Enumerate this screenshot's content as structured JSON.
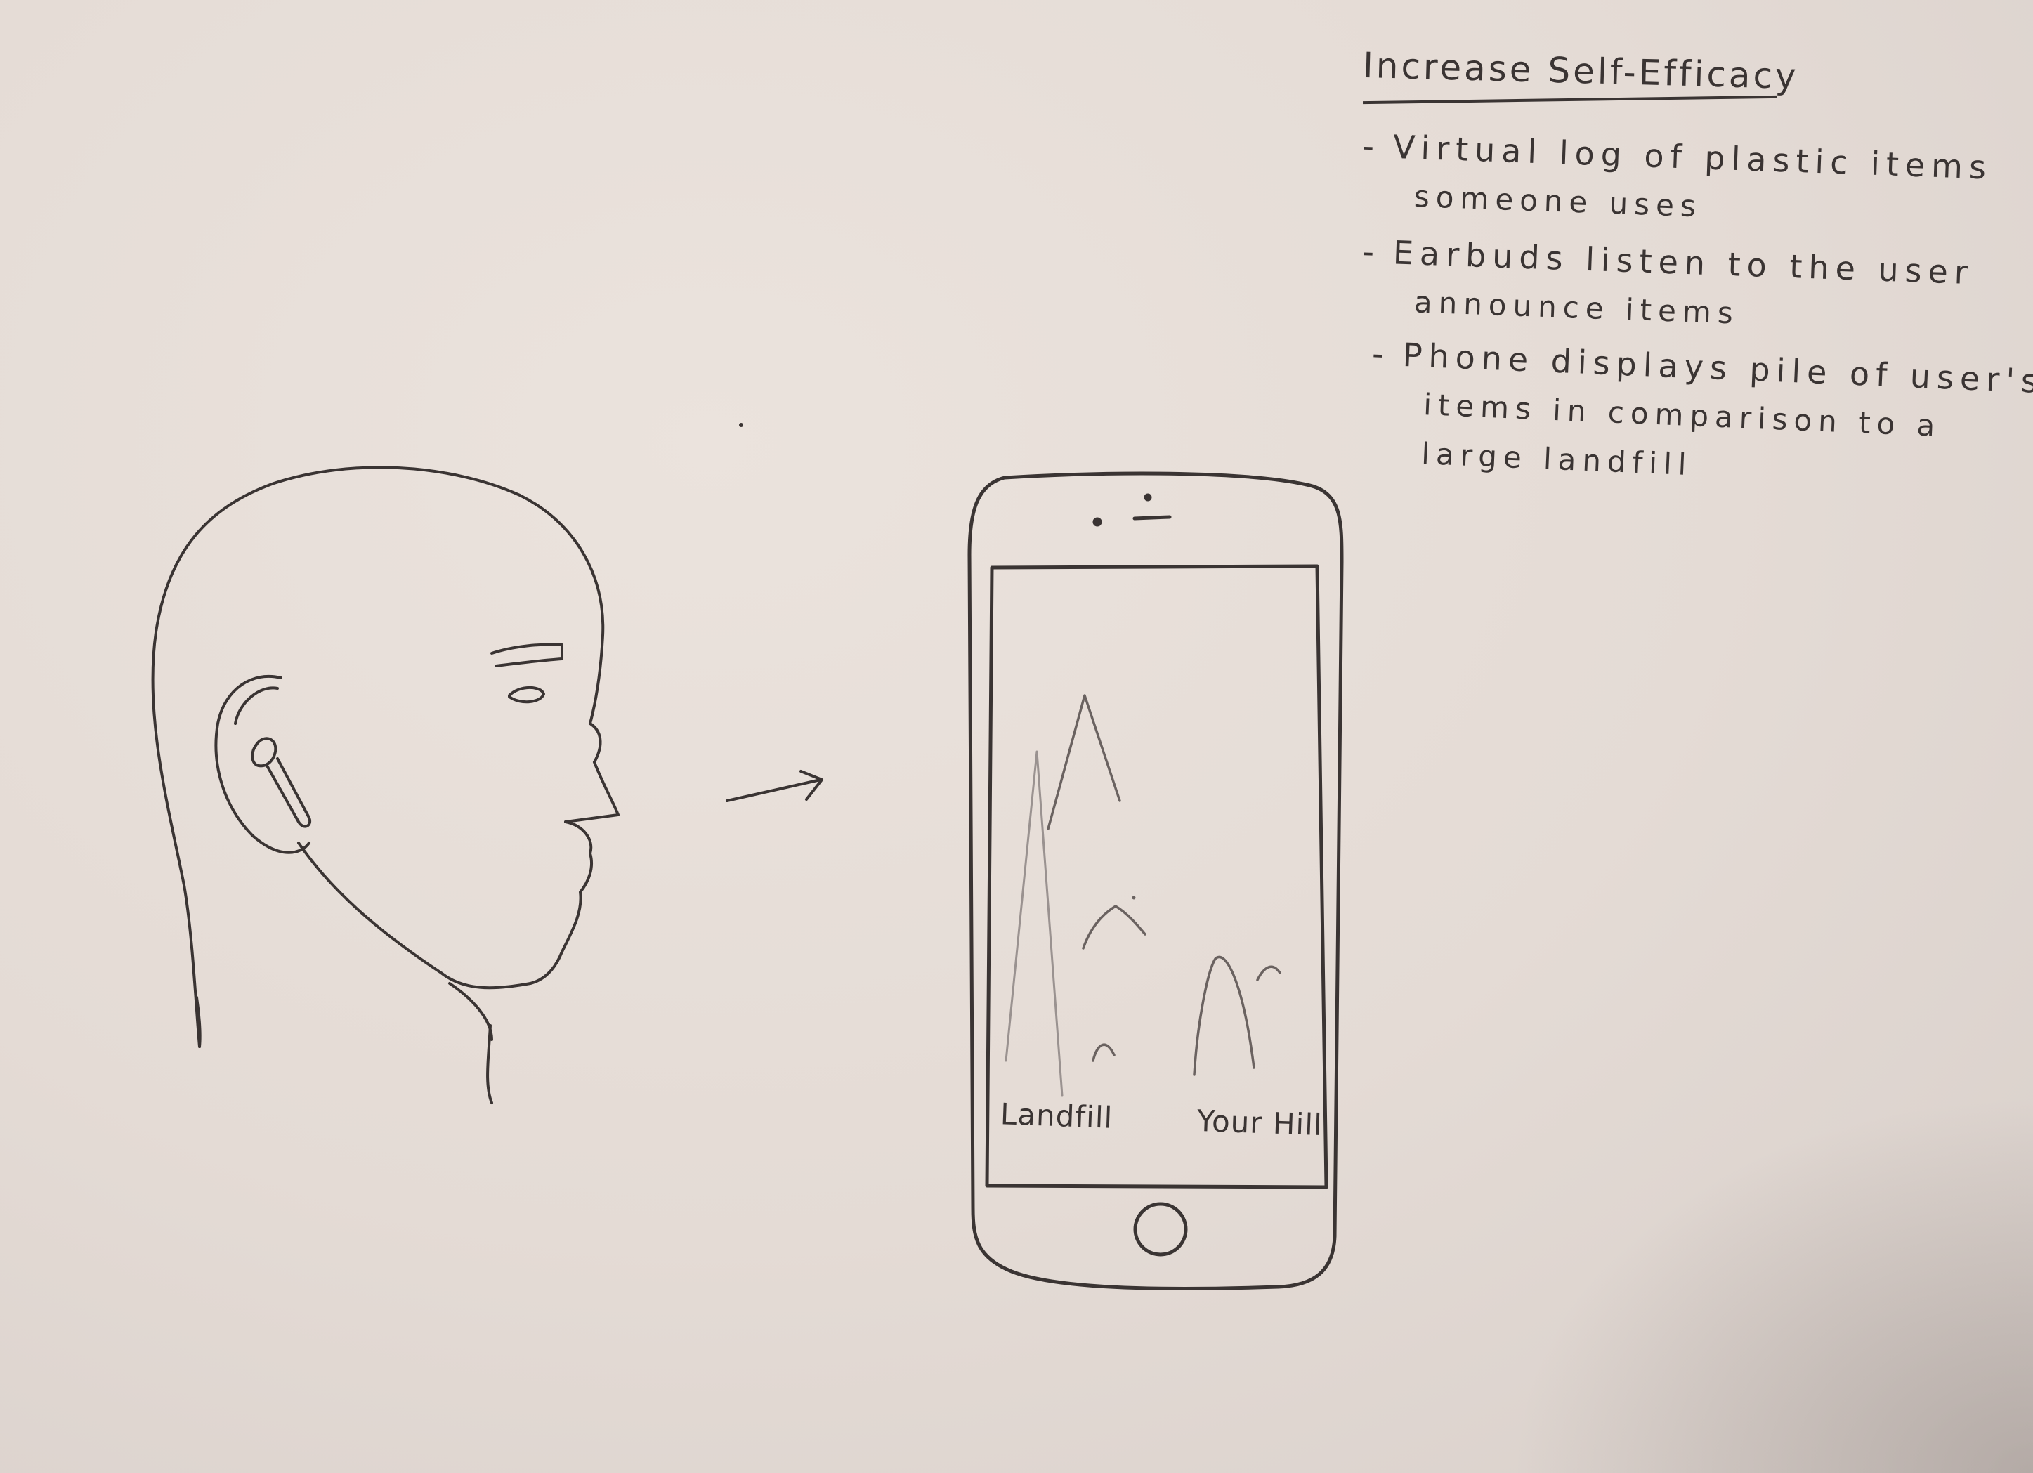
{
  "notes": {
    "title": "Increase Self-Efficacy",
    "bullets": [
      {
        "dash": "-",
        "line1": "Virtual log of plastic items",
        "line2": "someone uses"
      },
      {
        "dash": "-",
        "line1": "Earbuds listen to the user",
        "line2": "announce items"
      },
      {
        "dash": "-",
        "line1": "Phone displays pile of user's",
        "line2": "items in comparison to a",
        "line3": "large landfill"
      }
    ]
  },
  "phone_screen": {
    "left_label": "Landfill",
    "right_label": "Your Hill"
  },
  "colors": {
    "paper": "#e5dcd6",
    "ink": "#3a3433",
    "pencil": "#9a9290"
  },
  "icons": {
    "earbud": "earbud-icon",
    "arrow": "arrow-right-icon",
    "home_button": "home-button-icon"
  }
}
